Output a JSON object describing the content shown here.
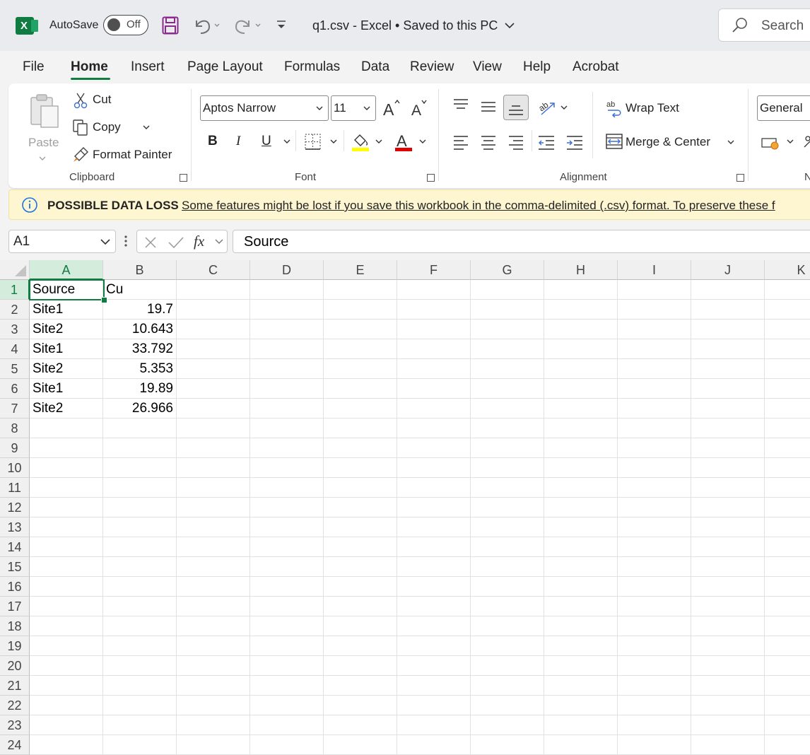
{
  "titlebar": {
    "autosave_label": "AutoSave",
    "autosave_state": "Off",
    "doc_title": "q1.csv  -  Excel • Saved to this PC",
    "search_placeholder": "Search"
  },
  "tabs": [
    "File",
    "Home",
    "Insert",
    "Page Layout",
    "Formulas",
    "Data",
    "Review",
    "View",
    "Help",
    "Acrobat"
  ],
  "active_tab": "Home",
  "clipboard": {
    "paste": "Paste",
    "cut": "Cut",
    "copy": "Copy",
    "format_painter": "Format Painter",
    "group_label": "Clipboard"
  },
  "font": {
    "font_name": "Aptos Narrow",
    "font_size": "11",
    "bold": "B",
    "italic": "I",
    "underline": "U",
    "group_label": "Font",
    "highlight_color": "#ffff00",
    "font_color": "#e00000"
  },
  "alignment": {
    "wrap_text": "Wrap Text",
    "merge_center": "Merge & Center",
    "group_label": "Alignment"
  },
  "number": {
    "format": "General",
    "group_label": "N"
  },
  "message_bar": {
    "title": "POSSIBLE DATA LOSS",
    "text": "Some features might be lost if you save this workbook in the comma-delimited (.csv) format. To preserve these f"
  },
  "formula_bar": {
    "name_box": "A1",
    "fx": "fx",
    "content": "Source"
  },
  "sheet": {
    "columns": [
      "A",
      "B",
      "C",
      "D",
      "E",
      "F",
      "G",
      "H",
      "I",
      "J",
      "K"
    ],
    "row_count": 24,
    "selected_cell": "A1",
    "cells": [
      [
        "Source",
        "Cu"
      ],
      [
        "Site1",
        "19.7"
      ],
      [
        "Site2",
        "10.643"
      ],
      [
        "Site1",
        "33.792"
      ],
      [
        "Site2",
        "5.353"
      ],
      [
        "Site1",
        "19.89"
      ],
      [
        "Site2",
        "26.966"
      ]
    ]
  },
  "colors": {
    "accent": "#107c41",
    "message_bar_bg": "#fdf6d0"
  }
}
